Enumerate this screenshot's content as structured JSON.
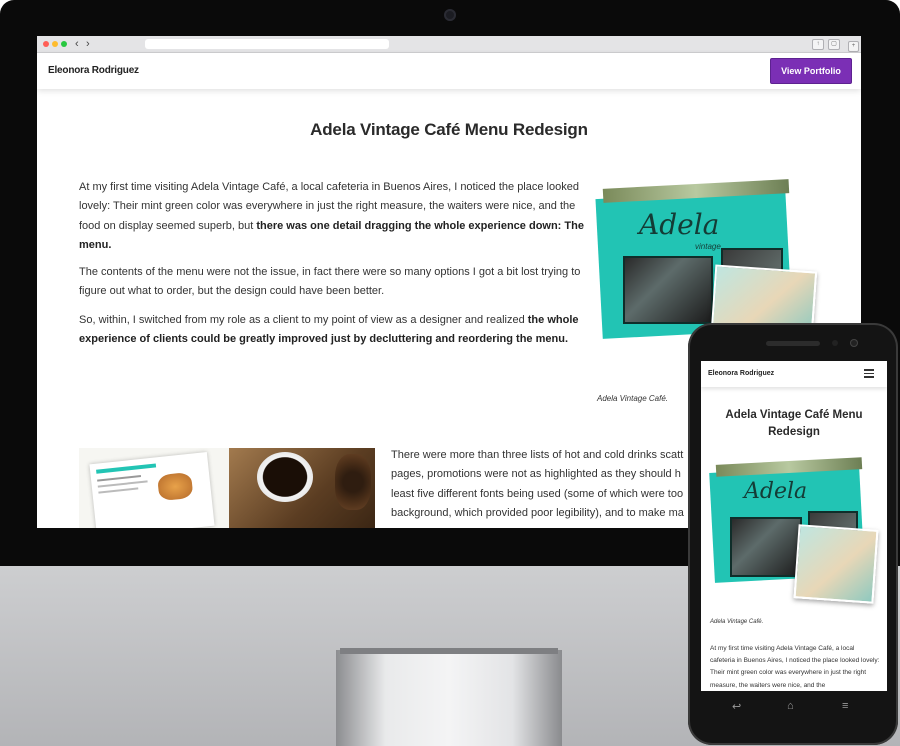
{
  "desktop": {
    "brand": "Eleonora Rodriguez",
    "cta_label": "View Portfolio",
    "page_title": "Adela Vintage Café Menu Redesign",
    "paragraphs": {
      "p1_a": "At my first time visiting Adela Vintage Café, a local cafeteria in Buenos Aires, I noticed the place looked lovely: Their mint green color was everywhere in just the right measure, the waiters were nice, and the food on display seemed superb, but ",
      "p1_b": "there was one detail dragging the whole experience down: The menu.",
      "p2": "The contents of the menu were not the issue, in fact there were so many options I got a bit lost trying to figure out what to order, but the design could have been better.",
      "p3_a": "So, within, I switched from my role as a client to my point of view as a designer and realized ",
      "p3_b": "the whole experience of clients could be greatly improved just by decluttering and reordering the menu.",
      "caption": "Adela Vintage Café.",
      "p4_l1": "There were more than three lists of hot and cold drinks scatt",
      "p4_l2": "pages, promotions were not as highlighted as they should h",
      "p4_l3": "least five different fonts being used (some of which were too",
      "p4_l4": "background, which provided poor legibility), and to make ma"
    },
    "sign_text": "Adela",
    "sign_sub": "vintage"
  },
  "mobile": {
    "brand": "Eleonora Rodriguez",
    "page_title": "Adela Vintage Café Menu Redesign",
    "caption": "Adela Vintage Café.",
    "paragraph": "At my first time visiting Adela Vintage Café, a local cafeteria in Buenos Aires, I noticed the place looked lovely: Their mint green color was everywhere in just the right measure, the waiters were nice, and the",
    "menu_icon": "hamburger-icon"
  },
  "colors": {
    "accent": "#7b2fb5",
    "cafe_teal": "#22c4b4"
  }
}
